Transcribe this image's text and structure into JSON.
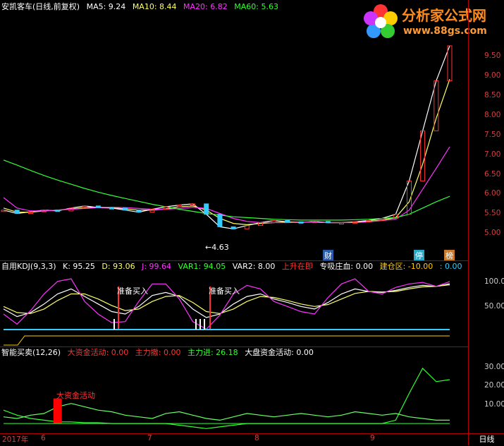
{
  "price_header": {
    "title": "安凯客车(日线,前复权)",
    "ma5": "MA5: 9.24",
    "ma10": "MA10: 8.44",
    "ma20": "MA20: 6.82",
    "ma60": "MA60: 5.63",
    "colors": {
      "title": "#ffffff",
      "ma5": "#ffffff",
      "ma10": "#ffff66",
      "ma20": "#ff33ff",
      "ma60": "#33ff33"
    }
  },
  "price_axis": [
    "9.50",
    "9.00",
    "8.50",
    "8.00",
    "7.50",
    "7.00",
    "6.50",
    "6.00",
    "5.50",
    "5.00"
  ],
  "low_label": "4.63",
  "markers": {
    "cai": "财",
    "ting": "停",
    "bang": "榜"
  },
  "kdj_header": {
    "name": "自用KDJ(9,3,3)",
    "k": "K: 95.25",
    "d": "D: 93.06",
    "j": "J: 99.64",
    "var1": "VAR1: 94.05",
    "var2": "VAR2: 8.00",
    "up": "上升在即",
    "zhuanxi": "专吸庄血: 0.00",
    "jiancang": "建仓区: -10.00",
    "last": ": 0.00"
  },
  "kdj_axis": [
    "100.0",
    "50.00"
  ],
  "kdj_notes": [
    "准备买入",
    "准备买入"
  ],
  "fund_header": {
    "name": "智能买卖(12,26)",
    "big": "大资金活动: 0.00",
    "retreat": "主力撤: 0.00",
    "enter": "主力进: 26.18",
    "market": "大盘资金活动: 0.00"
  },
  "fund_axis": [
    "30.00",
    "20.00",
    "10.00"
  ],
  "fund_note": "大资金活动",
  "x_axis": [
    "2017年",
    "6",
    "7",
    "8",
    "9"
  ],
  "period": "日线",
  "logo": {
    "title": "分析家公式网",
    "url": "www.88gs.com"
  },
  "chart_data": [
    {
      "type": "line",
      "title": "安凯客车(日线,前复权)",
      "ylim": [
        4.5,
        10.0
      ],
      "series": [
        {
          "name": "MA5",
          "values": [
            5.3,
            5.22,
            5.26,
            5.3,
            5.28,
            5.35,
            5.4,
            5.36,
            5.35,
            5.3,
            5.25,
            5.32,
            5.38,
            5.42,
            5.45,
            5.2,
            4.9,
            4.85,
            4.93,
            5.0,
            5.05,
            5.02,
            5.0,
            5.03,
            5.0,
            5.0,
            5.02,
            5.05,
            5.1,
            5.2,
            6.0,
            7.2,
            8.4,
            9.24
          ]
        },
        {
          "name": "MA10",
          "values": [
            5.35,
            5.25,
            5.25,
            5.28,
            5.3,
            5.33,
            5.36,
            5.37,
            5.36,
            5.33,
            5.3,
            5.3,
            5.33,
            5.38,
            5.4,
            5.3,
            5.1,
            4.98,
            4.95,
            4.98,
            5.0,
            5.02,
            5.01,
            5.01,
            5.0,
            5.0,
            5.01,
            5.03,
            5.06,
            5.12,
            5.5,
            6.4,
            7.5,
            8.44
          ]
        },
        {
          "name": "MA20",
          "values": [
            5.6,
            5.35,
            5.28,
            5.28,
            5.3,
            5.32,
            5.34,
            5.36,
            5.37,
            5.36,
            5.34,
            5.32,
            5.32,
            5.34,
            5.37,
            5.34,
            5.22,
            5.1,
            5.03,
            5.0,
            5.0,
            5.0,
            5.01,
            5.01,
            5.0,
            5.0,
            5.0,
            5.02,
            5.05,
            5.08,
            5.3,
            5.8,
            6.3,
            6.82
          ]
        },
        {
          "name": "MA60",
          "values": [
            6.5,
            6.38,
            6.25,
            6.13,
            6.02,
            5.92,
            5.82,
            5.73,
            5.65,
            5.58,
            5.51,
            5.44,
            5.38,
            5.32,
            5.27,
            5.22,
            5.18,
            5.14,
            5.12,
            5.1,
            5.08,
            5.07,
            5.06,
            5.06,
            5.06,
            5.06,
            5.07,
            5.08,
            5.1,
            5.12,
            5.2,
            5.35,
            5.5,
            5.63
          ]
        }
      ]
    },
    {
      "type": "line",
      "title": "自用KDJ(9,3,3)",
      "ylim": [
        0,
        115
      ],
      "series": [
        {
          "name": "K",
          "values": [
            45,
            30,
            38,
            55,
            75,
            85,
            70,
            55,
            40,
            35,
            50,
            72,
            78,
            70,
            45,
            28,
            35,
            55,
            70,
            75,
            65,
            58,
            50,
            45,
            58,
            75,
            85,
            80,
            78,
            82,
            88,
            92,
            90,
            95.25
          ]
        },
        {
          "name": "D",
          "values": [
            50,
            38,
            36,
            45,
            62,
            75,
            75,
            65,
            52,
            42,
            45,
            60,
            70,
            72,
            58,
            40,
            36,
            45,
            60,
            70,
            68,
            62,
            55,
            50,
            54,
            65,
            76,
            80,
            79,
            80,
            85,
            89,
            90,
            93.06
          ]
        },
        {
          "name": "J",
          "values": [
            35,
            15,
            42,
            75,
            100,
            105,
            60,
            35,
            18,
            20,
            60,
            95,
            95,
            65,
            20,
            5,
            33,
            75,
            92,
            85,
            60,
            50,
            40,
            35,
            68,
            95,
            105,
            80,
            75,
            88,
            95,
            98,
            90,
            99.64
          ]
        }
      ]
    },
    {
      "type": "line",
      "title": "智能买卖(12,26)",
      "ylim": [
        -5,
        38
      ],
      "series": [
        {
          "name": "主力进",
          "values": [
            8,
            5,
            3,
            2,
            1,
            1,
            0.5,
            0.5,
            0,
            0,
            0,
            0,
            0,
            -1,
            -2,
            -3,
            -2,
            -1,
            0,
            0,
            0,
            0,
            0,
            0,
            0,
            0,
            0,
            0,
            0,
            2,
            18,
            33,
            25,
            26.18
          ]
        },
        {
          "name": "大盘资金活动",
          "values": [
            4,
            3,
            5,
            6,
            10,
            12,
            10,
            8,
            7,
            5,
            4,
            3,
            6,
            7,
            5,
            3,
            2,
            4,
            6,
            5,
            4,
            5,
            6,
            5,
            4,
            5,
            7,
            6,
            5,
            6,
            4,
            3,
            2,
            2
          ]
        },
        {
          "name": "大资金活动",
          "values": [
            0,
            0,
            0,
            0,
            15,
            0,
            0,
            0,
            0,
            0,
            0,
            0,
            0,
            0,
            0,
            0,
            0,
            0,
            0,
            0,
            0,
            0,
            0,
            0,
            0,
            0,
            0,
            0,
            0,
            0,
            0,
            0,
            0,
            0
          ]
        }
      ]
    }
  ]
}
